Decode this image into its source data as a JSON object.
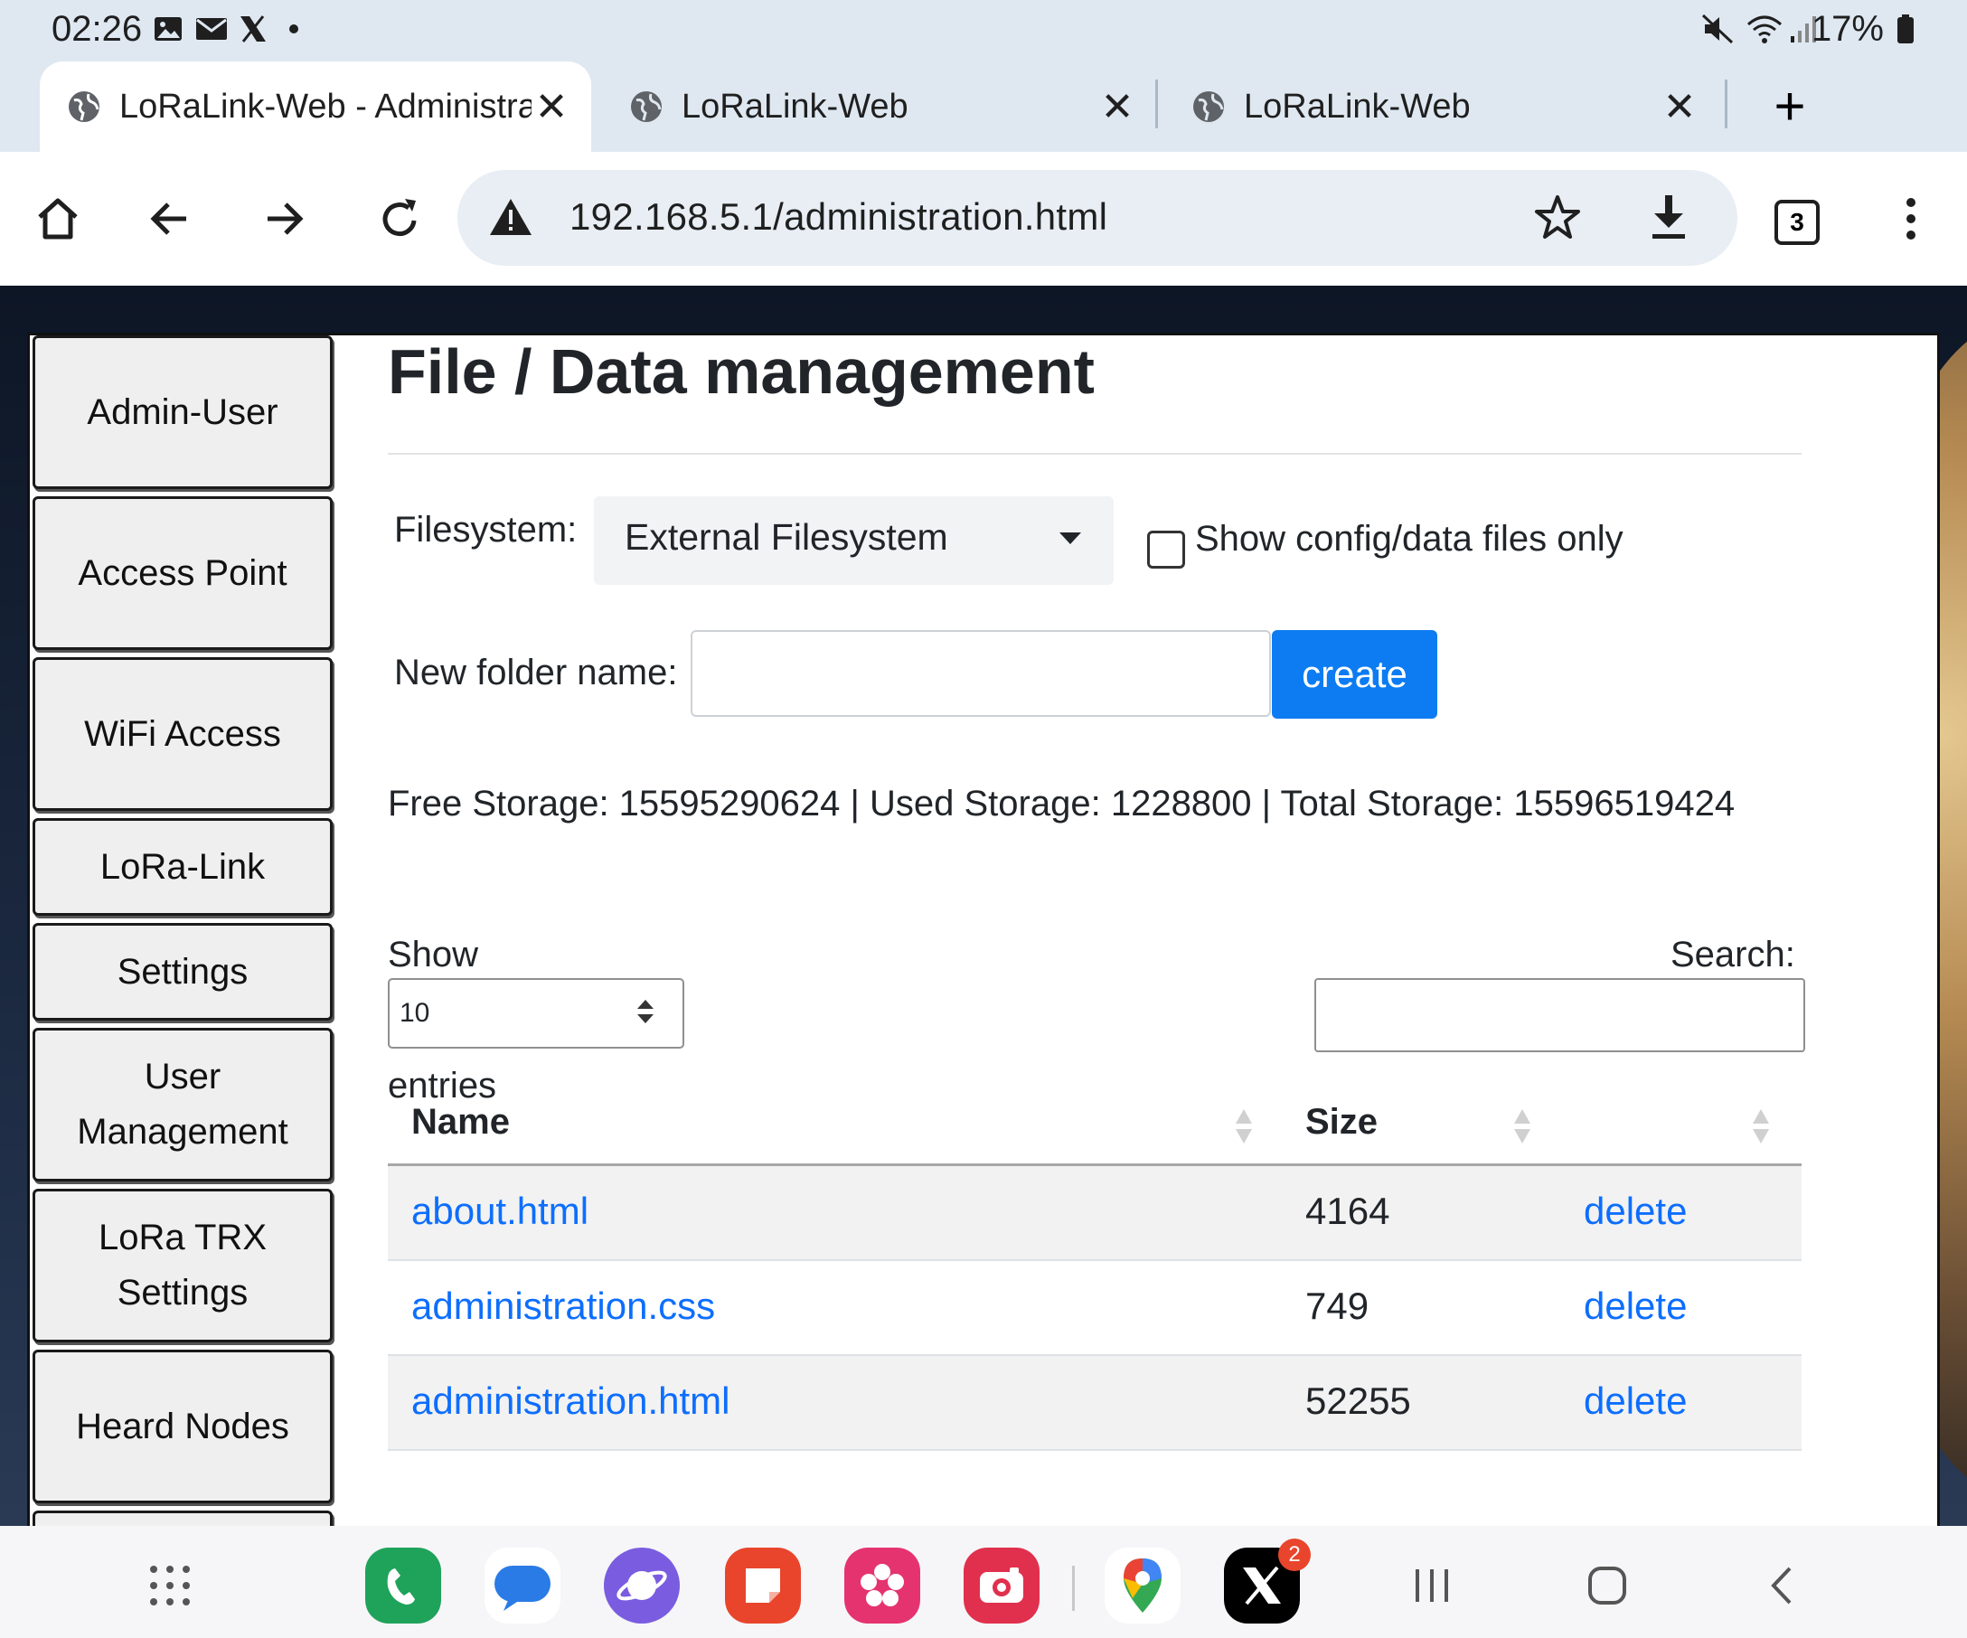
{
  "status_bar": {
    "time": "02:26",
    "battery": "17%",
    "left_icons": [
      "gallery-icon",
      "mail-icon",
      "x-app-icon",
      "dot-icon"
    ],
    "right_icons": [
      "mute-icon",
      "wifi-icon",
      "signal-icon",
      "battery-icon"
    ]
  },
  "browser": {
    "tabs": [
      {
        "title": "LoRaLink-Web - Administration",
        "active": true
      },
      {
        "title": "LoRaLink-Web",
        "active": false
      },
      {
        "title": "LoRaLink-Web",
        "active": false
      }
    ],
    "url": "192.168.5.1/administration.html",
    "tab_count": "3",
    "security_warning": true
  },
  "sidebar": {
    "items": [
      {
        "label": "Admin-User"
      },
      {
        "label": "Access Point"
      },
      {
        "label": "WiFi Access"
      },
      {
        "label": "LoRa-Link"
      },
      {
        "label": "Settings"
      },
      {
        "label": "User Management"
      },
      {
        "label": "LoRa TRX Settings"
      },
      {
        "label": "Heard Nodes"
      }
    ]
  },
  "main": {
    "title": "File / Data management",
    "filesystem_label": "Filesystem:",
    "filesystem_value": "External Filesystem",
    "config_only_label": "Show config/data files only",
    "config_only_checked": false,
    "new_folder_label": "New folder name:",
    "new_folder_value": "",
    "create_label": "create",
    "storage_text": "Free Storage: 15595290624 | Used Storage: 1228800 | Total Storage: 15596519424",
    "show_label": "Show",
    "entries_value": "10",
    "entries_label": "entries",
    "search_label": "Search:",
    "search_value": ""
  },
  "table": {
    "headers": [
      "Name",
      "Size",
      ""
    ],
    "rows": [
      {
        "name": "about.html",
        "size": "4164",
        "action": "delete"
      },
      {
        "name": "administration.css",
        "size": "749",
        "action": "delete"
      },
      {
        "name": "administration.html",
        "size": "52255",
        "action": "delete"
      }
    ]
  },
  "dock": {
    "apps": [
      "phone-app-icon",
      "messages-app-icon",
      "samsung-internet-app-icon",
      "notes-app-icon",
      "bixby-app-icon",
      "camera-app-icon",
      "google-maps-app-icon",
      "x-app-icon"
    ],
    "x_badge": "2",
    "colors": {
      "phone": "#1fa35a",
      "messages": "#2a7be6",
      "internet": "#7a5ce0",
      "notes": "#e8452c",
      "flower": "#e5336f",
      "camera": "#e0304d",
      "x": "#000000"
    }
  },
  "colors": {
    "accent": "#0d7cf2",
    "link": "#0d6efd",
    "chrome_bg": "#dfe8f1"
  }
}
